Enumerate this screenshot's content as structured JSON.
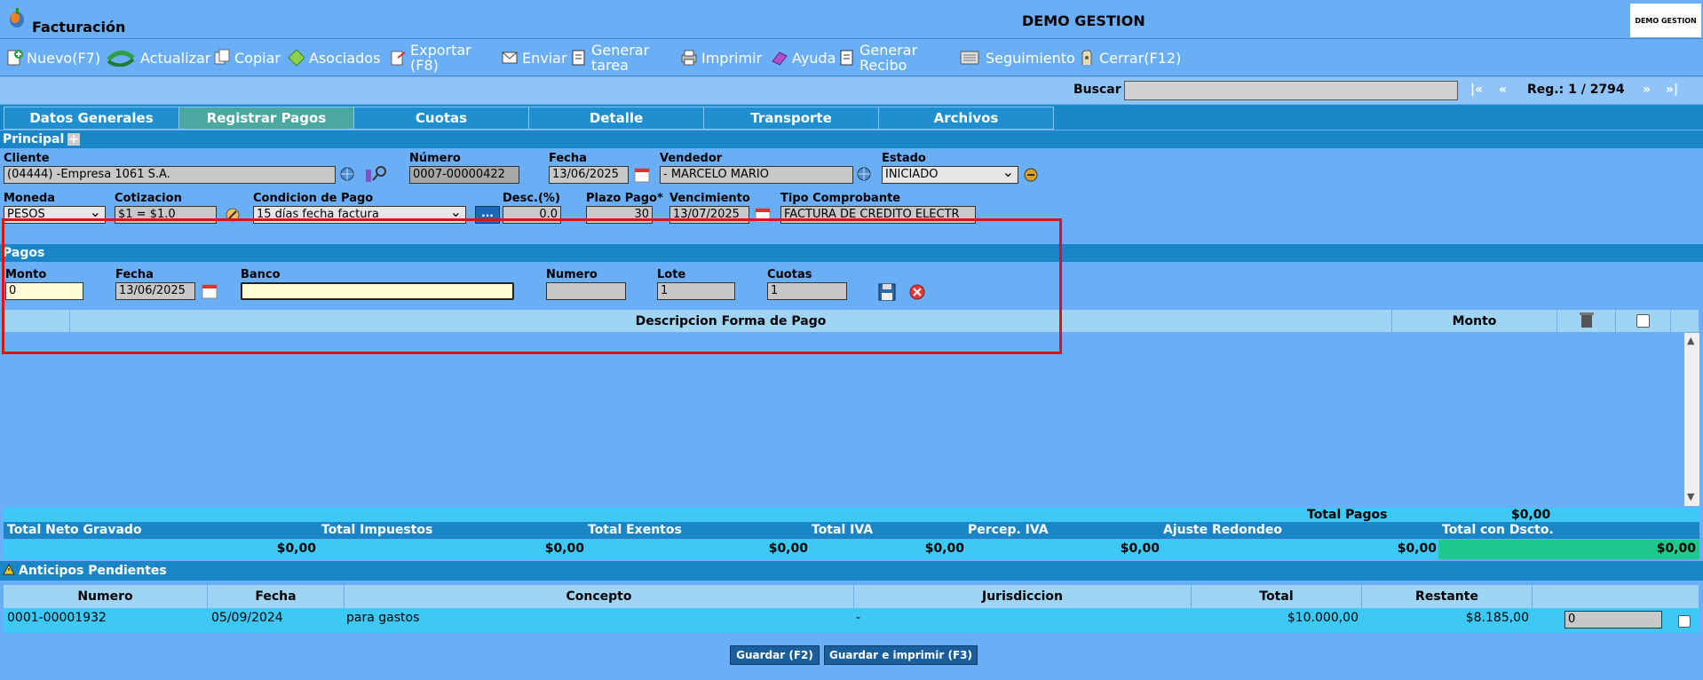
{
  "app": {
    "title": "Facturación",
    "company": "DEMO GESTION",
    "logo_text": "DEMO GESTION"
  },
  "toolbar": [
    {
      "label": "Nuevo(F7)",
      "icon": "new-icon"
    },
    {
      "label": "Actualizar",
      "icon": "refresh-icon"
    },
    {
      "label": "Copiar",
      "icon": "copy-icon"
    },
    {
      "label": "Asociados",
      "icon": "associated-icon"
    },
    {
      "label": "Exportar (F8)",
      "icon": "export-icon"
    },
    {
      "label": "Enviar",
      "icon": "send-icon"
    },
    {
      "label": "Generar tarea",
      "icon": "task-icon"
    },
    {
      "label": "Imprimir",
      "icon": "print-icon"
    },
    {
      "label": "Ayuda",
      "icon": "help-icon"
    },
    {
      "label": "Generar Recibo",
      "icon": "receipt-icon"
    },
    {
      "label": "Seguimiento",
      "icon": "tracking-icon"
    },
    {
      "label": "Cerrar(F12)",
      "icon": "close-icon"
    }
  ],
  "search": {
    "label": "Buscar",
    "value": "",
    "record": "Reg.: 1 / 2794",
    "first": "|«",
    "prev": "«",
    "next": "»",
    "last": "»|"
  },
  "tabs": [
    "Datos Generales",
    "Registrar Pagos",
    "Cuotas",
    "Detalle",
    "Transporte",
    "Archivos"
  ],
  "principal": {
    "title": "Principal",
    "cliente_label": "Cliente",
    "cliente": "(04444) -Empresa 1061 S.A.",
    "numero_label": "Número",
    "numero": "0007-00000422",
    "fecha_label": "Fecha",
    "fecha": "13/06/2025",
    "vendedor_label": "Vendedor",
    "vendedor": "- MARCELO MARIO",
    "estado_label": "Estado",
    "estado": "INICIADO",
    "moneda_label": "Moneda",
    "moneda": "PESOS",
    "cotizacion_label": "Cotizacion",
    "cotizacion": "$1 = $1.0",
    "condicion_label": "Condicion de Pago",
    "condicion": "15 días fecha factura",
    "desc_label": "Desc.(%)",
    "desc": "0.0",
    "plazo_label": "Plazo Pago*",
    "plazo": "30",
    "vencimiento_label": "Vencimiento",
    "vencimiento": "13/07/2025",
    "tipo_label": "Tipo Comprobante",
    "tipo": "FACTURA DE CREDITO ELECTR",
    "dots": "..."
  },
  "pagos": {
    "title": "Pagos",
    "monto_label": "Monto",
    "monto": "0",
    "fecha_label": "Fecha",
    "fecha": "13/06/2025",
    "banco_label": "Banco",
    "banco": "",
    "numero_label": "Numero",
    "numero": "",
    "lote_label": "Lote",
    "lote": "1",
    "cuotas_label": "Cuotas",
    "cuotas": "1",
    "col_desc": "Descripcion Forma de Pago",
    "col_monto": "Monto"
  },
  "totals": {
    "total_pagos_label": "Total Pagos",
    "total_pagos": "$0,00",
    "headers": [
      "Total Neto Gravado",
      "Total Impuestos",
      "Total Exentos",
      "Total IVA",
      "Percep. IVA",
      "Ajuste Redondeo",
      "Total con Dscto."
    ],
    "values": [
      "$0,00",
      "$0,00",
      "$0,00",
      "$0,00",
      "$0,00",
      "$0,00",
      "$0,00"
    ]
  },
  "anticipos": {
    "title": "Anticipos Pendientes",
    "headers": [
      "Numero",
      "Fecha",
      "Concepto",
      "Jurisdiccion",
      "Total",
      "Restante"
    ],
    "rows": [
      {
        "numero": "0001-00001932",
        "fecha": "05/09/2024",
        "concepto": "para gastos",
        "jurisdiccion": "-",
        "total": "$10.000,00",
        "restante": "$8.185,00",
        "input": "0"
      }
    ]
  },
  "buttons": {
    "guardar": "Guardar (F2)",
    "guardar_imprimir": "Guardar e imprimir (F3)"
  },
  "colors": {
    "background": "#6aaef5",
    "header": "#1a86c8",
    "highlight_box": "#e0101a",
    "total_green": "#1ec890"
  }
}
